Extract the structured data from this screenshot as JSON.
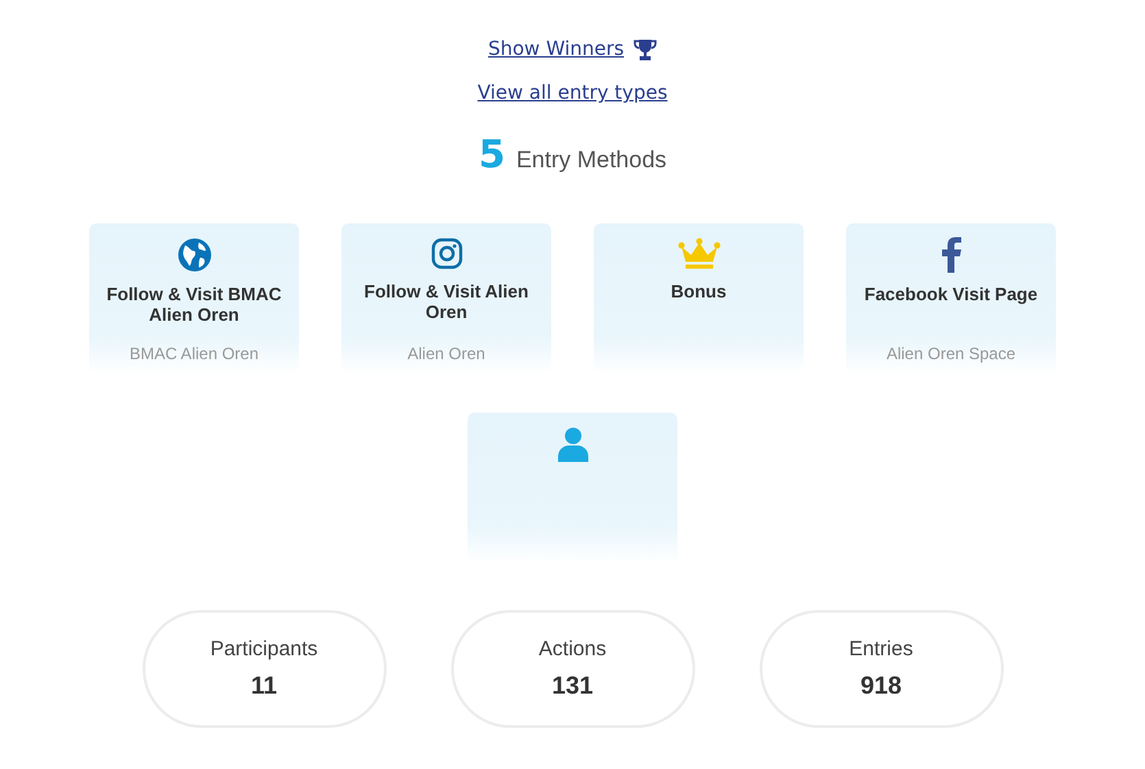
{
  "links": [
    {
      "label": "Show Winners",
      "kind": "trophy"
    },
    {
      "label": "View all entry types",
      "kind": "plain"
    }
  ],
  "heading": {
    "count": "5",
    "label": "Entry Methods"
  },
  "entry_methods": [
    {
      "kind": "globe",
      "title": "Follow & Visit BMAC Alien Oren",
      "subtitle": "BMAC Alien Oren"
    },
    {
      "kind": "instagram",
      "title": "Follow & Visit Alien Oren",
      "subtitle": "Alien Oren"
    },
    {
      "kind": "crown",
      "title": "Bonus"
    },
    {
      "kind": "facebook",
      "title": "Facebook Visit Page",
      "subtitle": "Alien Oren Space"
    },
    {
      "kind": "user"
    }
  ],
  "stats": [
    {
      "label": "Participants",
      "value": "11"
    },
    {
      "label": "Actions",
      "value": "131"
    },
    {
      "label": "Entries",
      "value": "918"
    }
  ]
}
